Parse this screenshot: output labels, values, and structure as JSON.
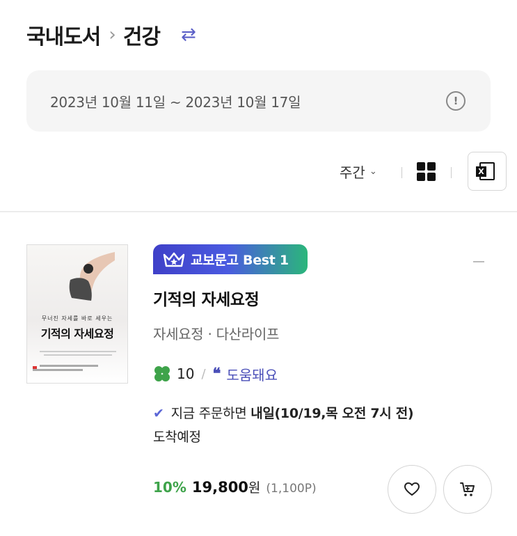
{
  "breadcrumb": {
    "category": "국내도서",
    "separator": "›",
    "subcategory": "건강",
    "swap_icon": "swap-icon"
  },
  "date_range": {
    "text": "2023년 10월 11일 ~ 2023년 10월 17일",
    "info_icon": "!"
  },
  "toolbar": {
    "period": "주간",
    "period_chevron": "⌄",
    "view_icon": "grid-view-icon",
    "excel_icon": "excel-download-icon",
    "excel_letter": "X"
  },
  "book": {
    "rank_label": "교보문고 Best 1",
    "title": "기적의 자세요정",
    "meta": "자세요정 · 다산라이프",
    "review_count": "10",
    "review_slash": "/",
    "quote_mark": "❝",
    "helpful_label": "도움돼요",
    "delivery_check": "✔",
    "delivery_prefix": "지금 주문하면 ",
    "delivery_bold": "내일(10/19,목 오전 7시 전)",
    "delivery_suffix": "도착예정",
    "discount": "10%",
    "price": "19,800",
    "currency": "원",
    "points": "(1,100P)",
    "cover": {
      "subtitle": "무너진 자세를 바로 세우는",
      "title": "기적의 자세요정"
    }
  },
  "colors": {
    "accent": "#4a4fb8",
    "discount_green": "#3ea34a",
    "badge_start": "#3f40c8",
    "badge_end": "#2bb67b"
  }
}
